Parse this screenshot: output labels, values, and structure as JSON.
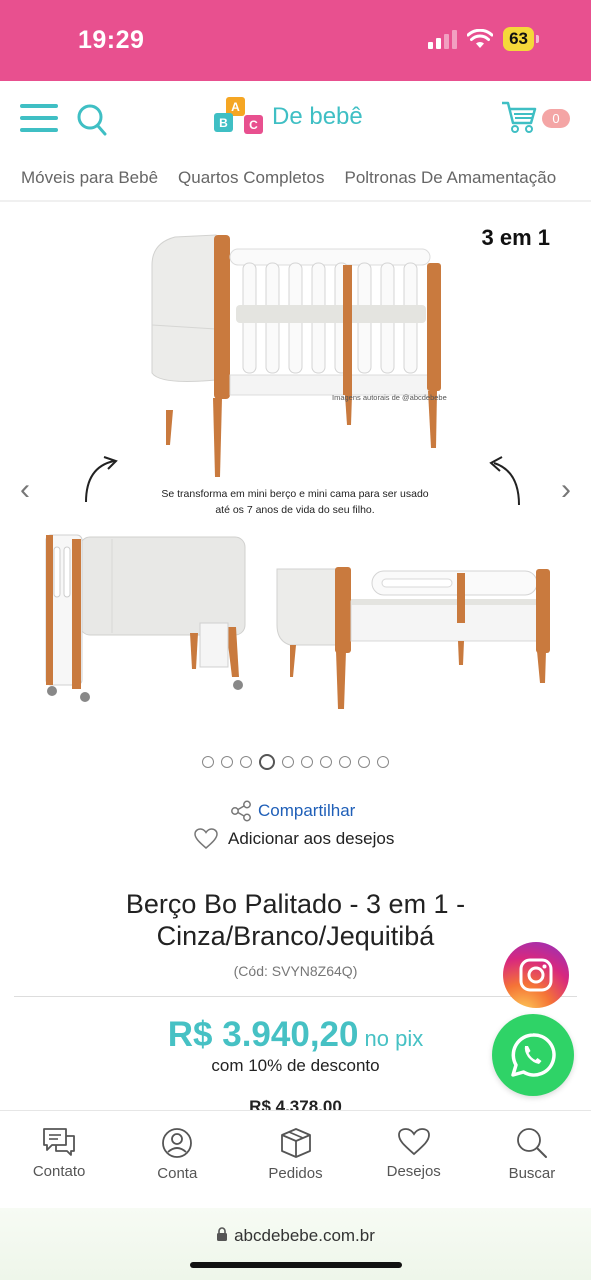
{
  "status_bar": {
    "time": "19:29",
    "battery": "63"
  },
  "header": {
    "logo_blocks": [
      "A",
      "B",
      "C"
    ],
    "logo_text": "De bebê",
    "cart_count": "0"
  },
  "categories": [
    "Móveis para Bebê",
    "Quartos Completos",
    "Poltronas De Amamentação"
  ],
  "gallery": {
    "badge": "3 em 1",
    "watermark": "Imagens autorais de @abcdebebe",
    "caption_line1": "Se transforma em mini berço e mini cama para ser usado",
    "caption_line2": "até os 7 anos de vida do seu filho.",
    "prev": "‹",
    "next": "›",
    "dot_count": 10,
    "active_dot": 4
  },
  "actions": {
    "share": "Compartilhar",
    "wishlist": "Adicionar aos desejos"
  },
  "product": {
    "title_line1": "Berço Bo Palitado - 3 em 1 -",
    "title_line2": "Cinza/Branco/Jequitibá",
    "code": "(Cód: SVYN8Z64Q)",
    "price": "R$ 3.940,20",
    "price_suffix": "no pix",
    "discount": "com 10% de desconto",
    "old_price": "R$ 4.378,00"
  },
  "bottom_nav": [
    "Contato",
    "Conta",
    "Pedidos",
    "Desejos",
    "Buscar"
  ],
  "url": "abcdebebe.com.br",
  "colors": {
    "brand_pink": "#e8508f",
    "brand_teal": "#3fbfc4",
    "price": "#46c1c4",
    "whatsapp": "#2fd367"
  }
}
